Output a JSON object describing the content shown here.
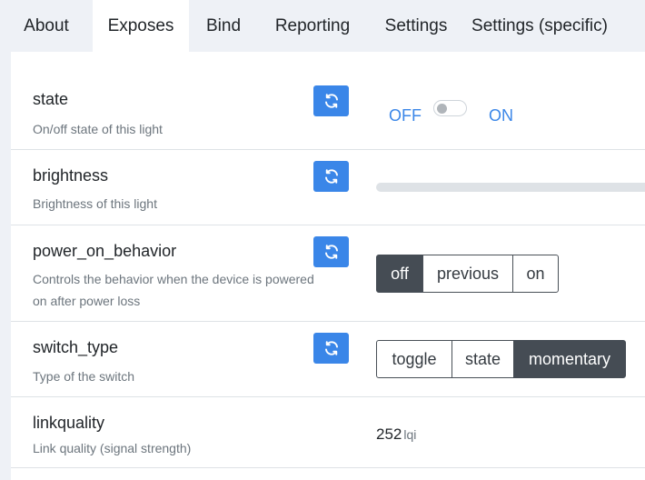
{
  "tabs": [
    {
      "label": "About"
    },
    {
      "label": "Exposes",
      "active": true
    },
    {
      "label": "Bind"
    },
    {
      "label": "Reporting"
    },
    {
      "label": "Settings"
    },
    {
      "label": "Settings (specific)"
    }
  ],
  "colors": {
    "accent": "#3a86e8",
    "active_button": "#454c54",
    "divider": "#dee2e6",
    "muted_text": "#6c757d"
  },
  "features": {
    "state": {
      "name": "state",
      "description": "On/off state of this light",
      "off_label": "OFF",
      "on_label": "ON",
      "value": "OFF"
    },
    "brightness": {
      "name": "brightness",
      "description": "Brightness of this light"
    },
    "power_on_behavior": {
      "name": "power_on_behavior",
      "description_line1": "Controls the behavior when the device is powered",
      "description_line2": "on after power loss",
      "options": [
        "off",
        "previous",
        "on"
      ],
      "selected": "off"
    },
    "switch_type": {
      "name": "switch_type",
      "description": "Type of the switch",
      "options": [
        "toggle",
        "state",
        "momentary"
      ],
      "selected": "momentary"
    },
    "linkquality": {
      "name": "linkquality",
      "description": "Link quality (signal strength)",
      "value": "252",
      "unit": "lqi"
    }
  },
  "icons": {
    "refresh": "refresh-icon"
  }
}
